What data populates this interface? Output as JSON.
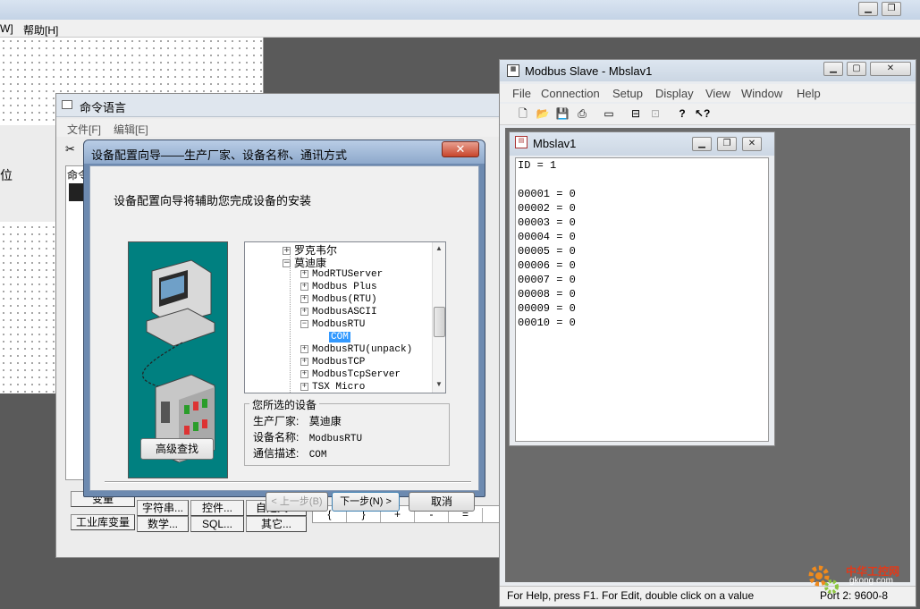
{
  "main_app": {
    "menu_fragment_left": "W]",
    "menu_help": "帮助[H]",
    "side_char": "位"
  },
  "cmd_window": {
    "title": "命令语言",
    "menu": [
      "文件[F]",
      "编辑[E]"
    ],
    "editor_label": "命令",
    "buttons_row1": [
      "变量",
      "字符串...",
      "控件...",
      "自定义..."
    ],
    "buttons_row2": [
      "工业库变量",
      "数学...",
      "SQL...",
      "其它..."
    ],
    "operators": [
      "{",
      "}",
      "+",
      "-",
      "="
    ]
  },
  "wizard": {
    "title": "设备配置向导——生产厂家、设备名称、通讯方式",
    "close_label": "✕",
    "intro": "设备配置向导将辅助您完成设备的安装",
    "tree": {
      "items": [
        {
          "label": "罗克韦尔",
          "box": "+"
        },
        {
          "label": "莫迪康",
          "box": "−"
        },
        {
          "label": "ModRTUServer",
          "box": "+"
        },
        {
          "label": "Modbus Plus",
          "box": "+"
        },
        {
          "label": "Modbus(RTU)",
          "box": "+"
        },
        {
          "label": "ModbusASCII",
          "box": "+"
        },
        {
          "label": "ModbusRTU",
          "box": "−"
        },
        {
          "label": "COM",
          "box": ""
        },
        {
          "label": "ModbusRTU(unpack)",
          "box": "+"
        },
        {
          "label": "ModbusTCP",
          "box": "+"
        },
        {
          "label": "ModbusTcpServer",
          "box": "+"
        },
        {
          "label": "TSX Micro",
          "box": "+"
        }
      ],
      "selected": "COM"
    },
    "selected_device": {
      "legend": "您所选的设备",
      "vendor_label": "生产厂家:",
      "vendor_value": "莫迪康",
      "device_label": "设备名称:",
      "device_value": "ModbusRTU",
      "comm_label": "通信描述:",
      "comm_value": "COM"
    },
    "advanced_button": "高级查找",
    "prev_button": "< 上一步(B)",
    "next_button": "下一步(N) >",
    "cancel_button": "取消"
  },
  "modbus_slave": {
    "title": "Modbus Slave - Mbslav1",
    "menu": [
      "File",
      "Connection",
      "Setup",
      "Display",
      "View",
      "Window",
      "Help"
    ],
    "child": {
      "title": "Mbslav1",
      "id_line": "ID = 1",
      "registers": [
        {
          "addr": "00001",
          "value": "0"
        },
        {
          "addr": "00002",
          "value": "0"
        },
        {
          "addr": "00003",
          "value": "0"
        },
        {
          "addr": "00004",
          "value": "0"
        },
        {
          "addr": "00005",
          "value": "0"
        },
        {
          "addr": "00006",
          "value": "0"
        },
        {
          "addr": "00007",
          "value": "0"
        },
        {
          "addr": "00008",
          "value": "0"
        },
        {
          "addr": "00009",
          "value": "0"
        },
        {
          "addr": "00010",
          "value": "0"
        }
      ]
    },
    "status_left": "For Help, press F1.  For Edit, double click on a value",
    "status_right": "Port 2: 9600-8"
  },
  "watermark": {
    "text": "中华工控网",
    "url": "gkong.com"
  },
  "colors": {
    "wizard_art_bg": "#008080",
    "tree_selection": "#3399ff",
    "close_red": "#c8452b"
  }
}
